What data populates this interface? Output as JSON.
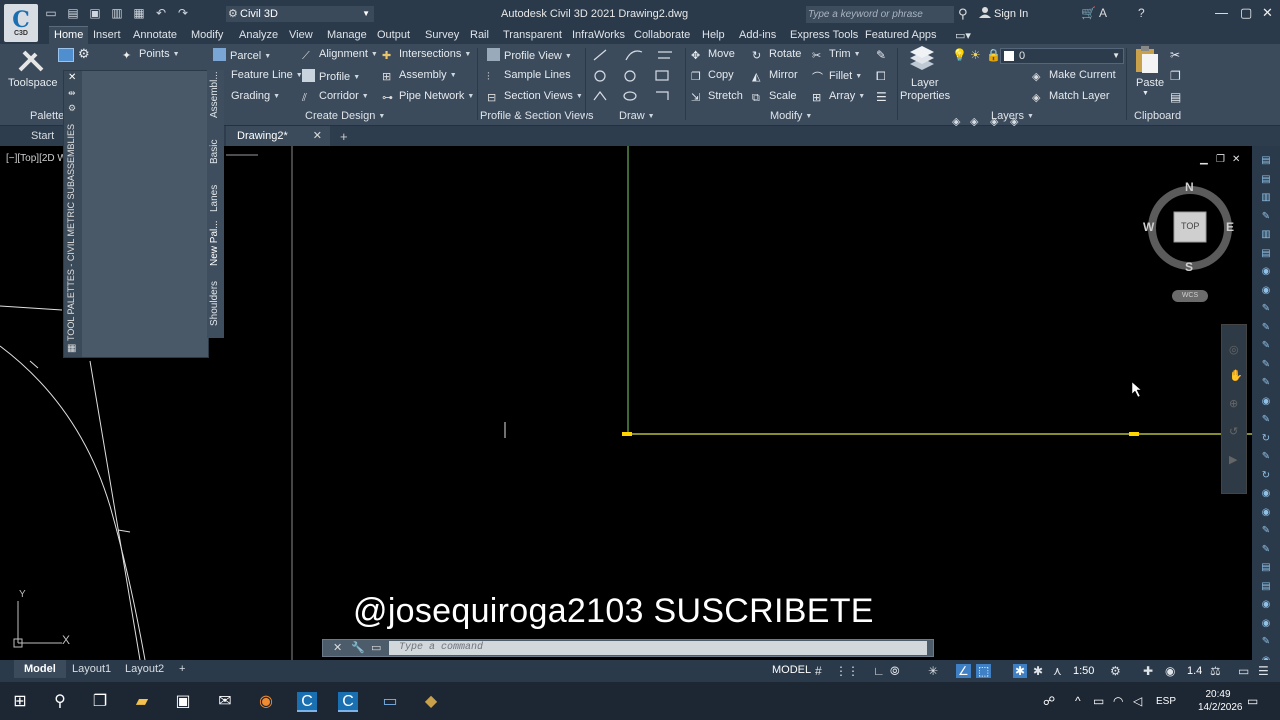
{
  "app": {
    "logo_text": "C",
    "logo_sub": "C3D",
    "title": "Autodesk Civil 3D 2021   Drawing2.dwg",
    "workspace": "Civil 3D",
    "search_placeholder": "Type a keyword or phrase",
    "sign_in": "Sign In"
  },
  "tabs": [
    "Home",
    "Insert",
    "Annotate",
    "Modify",
    "Analyze",
    "View",
    "Manage",
    "Output",
    "Survey",
    "Rail",
    "Transparent",
    "InfraWorks",
    "Collaborate",
    "Help",
    "Add-ins",
    "Express Tools",
    "Featured Apps"
  ],
  "ribbon": {
    "toolspace": "Toolspace",
    "palettes": "Palettes",
    "points": "Points",
    "parcel": "Parcel",
    "feature_line": "Feature Line",
    "grading": "Grading",
    "alignment": "Alignment",
    "profile": "Profile",
    "corridor": "Corridor",
    "intersections": "Intersections",
    "assembly": "Assembly",
    "pipe_network": "Pipe Network",
    "create_design": "Create Design",
    "profile_view": "Profile View",
    "sample_lines": "Sample Lines",
    "section_views": "Section Views",
    "profile_section_views": "Profile & Section Views",
    "draw": "Draw",
    "move": "Move",
    "rotate": "Rotate",
    "trim": "Trim",
    "copy": "Copy",
    "mirror": "Mirror",
    "fillet": "Fillet",
    "stretch": "Stretch",
    "scale": "Scale",
    "array": "Array",
    "modify": "Modify",
    "layer_properties_1": "Layer",
    "layer_properties_2": "Properties",
    "layer_name": "0",
    "make_current": "Make Current",
    "match_layer": "Match Layer",
    "layers": "Layers",
    "paste": "Paste",
    "clipboard": "Clipboard"
  },
  "doctabs": {
    "start": "Start",
    "drawing": "Drawing2*"
  },
  "viewport": {
    "label": "[−][Top][2D W",
    "watermark": "@josequiroga2103  SUSCRIBETE",
    "compass": {
      "n": "N",
      "s": "S",
      "e": "E",
      "w": "W",
      "top": "TOP",
      "wcs": "WCS"
    },
    "ucs_x": "X",
    "ucs_y": "Y"
  },
  "palette": {
    "title": "TOOL PALETTES - CIVIL METRIC SUBASSEMBLIES",
    "tabs": [
      "Assembl...",
      "Basic",
      "Lanes",
      "New Pal...",
      "Shoulders"
    ]
  },
  "command": {
    "placeholder": "Type a command"
  },
  "status": {
    "layouts": [
      "Model",
      "Layout1",
      "Layout2"
    ],
    "model": "MODEL",
    "scale": "1:50",
    "anno": "1.4"
  },
  "taskbar": {
    "time": "20:49",
    "date": "14/2/2026",
    "lang": "ESP"
  },
  "colors": {
    "title_bg": "#2b3a4a",
    "ribbon_bg": "#3b4b5c",
    "canvas_bg": "#000000",
    "line_green": "#7fd36a",
    "line_yellow": "#d8e04a",
    "grip_yellow": "#ffd400"
  }
}
